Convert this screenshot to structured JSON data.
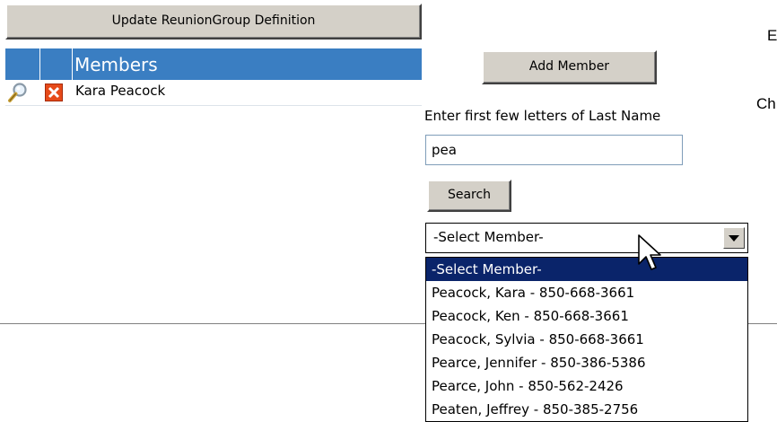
{
  "buttons": {
    "update": "Update ReunionGroup Definition",
    "add_member": "Add Member",
    "search": "Search"
  },
  "members": {
    "header": "Members",
    "rows": [
      {
        "name": "Kara Peacock"
      }
    ]
  },
  "search": {
    "label": "Enter first few letters of Last Name",
    "value": "pea"
  },
  "member_select": {
    "selected": "-Select Member-",
    "options": [
      "-Select Member-",
      "Peacock, Kara - 850-668-3661",
      "Peacock, Ken - 850-668-3661",
      "Peacock, Sylvia - 850-668-3661",
      "Pearce, Jennifer - 850-386-5386",
      "Pearce, John - 850-562-2426",
      "Peaten, Jeffrey - 850-385-2756"
    ]
  },
  "cut_off": {
    "right_top": "E",
    "right_mid": "Ch"
  },
  "colors": {
    "header_blue": "#3a7ec2",
    "selection_blue": "#0a246a",
    "button_face": "#d4d0c8"
  }
}
